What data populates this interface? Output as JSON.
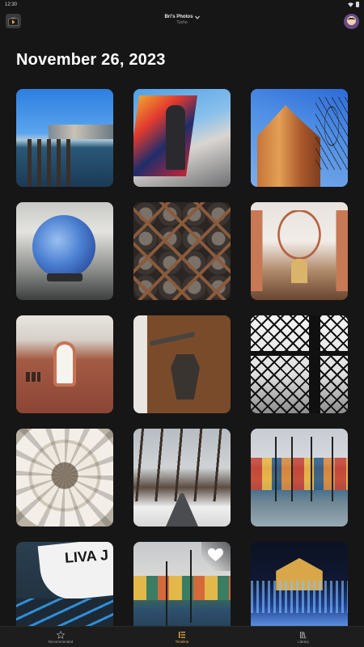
{
  "status_bar": {
    "time": "12:30"
  },
  "header": {
    "library_name": "Bri's Photos",
    "library_subtitle": "Tycho"
  },
  "timeline": {
    "date_heading": "November 26, 2023",
    "photos": [
      {
        "subject": "harbor waterfront",
        "favorite": false
      },
      {
        "subject": "person holding flag",
        "favorite": false
      },
      {
        "subject": "brick church tower",
        "favorite": false
      },
      {
        "subject": "blue glass globe",
        "favorite": false
      },
      {
        "subject": "ornate wooden lattice",
        "favorite": false
      },
      {
        "subject": "church interior",
        "favorite": false
      },
      {
        "subject": "arched window",
        "favorite": false
      },
      {
        "subject": "wooden door hinge",
        "favorite": false
      },
      {
        "subject": "lattice window",
        "favorite": false
      },
      {
        "subject": "domed ceiling",
        "favorite": false
      },
      {
        "subject": "snowy path",
        "favorite": false
      },
      {
        "subject": "canal houses",
        "favorite": false
      },
      {
        "subject": "boat hull",
        "favorite": false,
        "text": "LIVA J"
      },
      {
        "subject": "harbor with boats",
        "favorite": true
      },
      {
        "subject": "illuminated building",
        "favorite": false
      }
    ]
  },
  "bottom_nav": {
    "items": [
      {
        "label": "Recommended",
        "icon": "star-icon",
        "active": false
      },
      {
        "label": "Timeline",
        "icon": "timeline-icon",
        "active": true
      },
      {
        "label": "Library",
        "icon": "library-icon",
        "active": false
      }
    ]
  },
  "colors": {
    "background": "#161616",
    "accent": "#f0b24a",
    "nav_background": "#1d1d1d"
  }
}
